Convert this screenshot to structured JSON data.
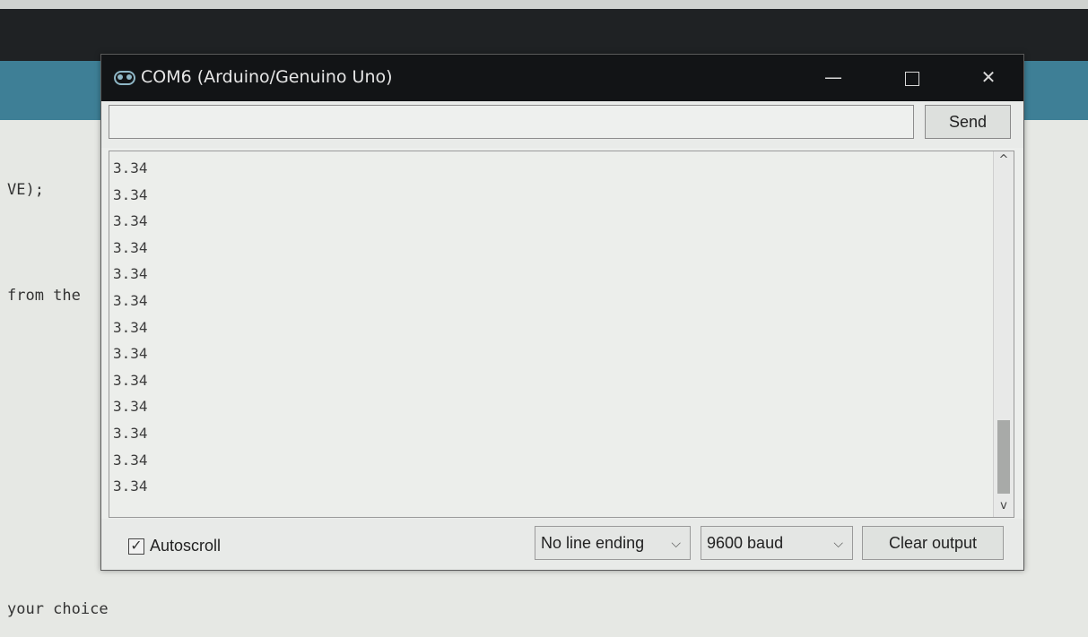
{
  "ide": {
    "code_lines": [
      "VE);",
      "from the",
      "your choice"
    ]
  },
  "window": {
    "title": "COM6 (Arduino/Genuino Uno)",
    "logo_icon": "arduino-logo-icon",
    "minimize_glyph": "—",
    "close_glyph": "✕"
  },
  "send": {
    "input_value": "",
    "button_label": "Send"
  },
  "output": {
    "lines": [
      "3.34",
      "3.34",
      "3.34",
      "3.34",
      "3.34",
      "3.34",
      "3.34",
      "3.34",
      "3.34",
      "3.34",
      "3.34",
      "3.34",
      "3.34"
    ]
  },
  "scrollbar": {
    "up_glyph": "^",
    "down_glyph": "v"
  },
  "bottom": {
    "autoscroll_label": "Autoscroll",
    "autoscroll_checked": true,
    "checkmark": "✓",
    "line_ending": "No line ending",
    "baud": "9600 baud",
    "chevron": "⌵",
    "clear_label": "Clear output"
  }
}
